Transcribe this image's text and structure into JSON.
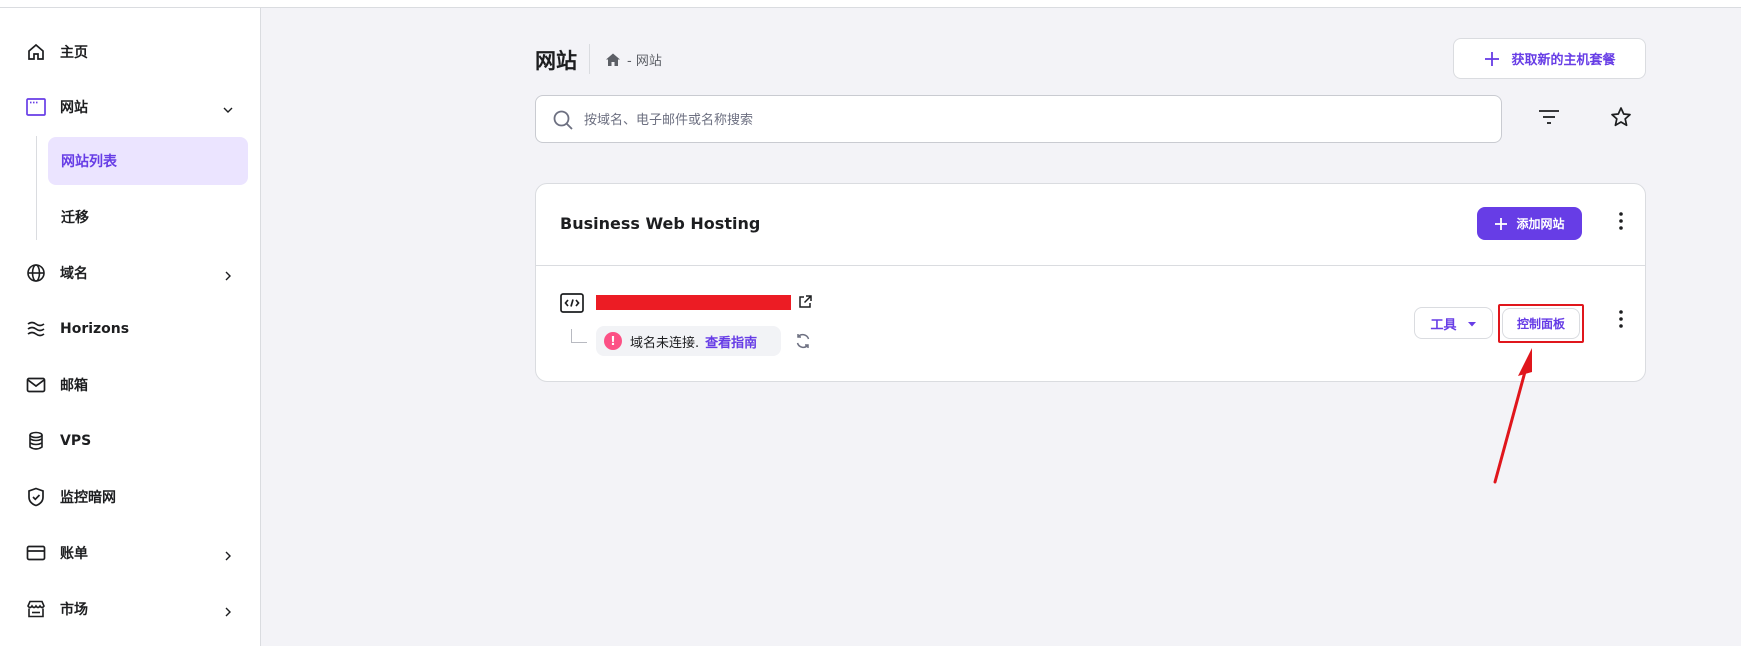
{
  "sidebar": {
    "items": [
      {
        "label": "主页",
        "icon": "home-icon"
      },
      {
        "label": "网站",
        "icon": "browser-window-icon",
        "expanded": true
      },
      {
        "label": "域名",
        "icon": "globe-icon"
      },
      {
        "label": "Horizons",
        "icon": "waves-icon"
      },
      {
        "label": "邮箱",
        "icon": "mail-icon"
      },
      {
        "label": "VPS",
        "icon": "database-icon"
      },
      {
        "label": "监控暗网",
        "icon": "shield-icon"
      },
      {
        "label": "账单",
        "icon": "card-icon"
      },
      {
        "label": "市场",
        "icon": "store-icon"
      }
    ],
    "sub_items": [
      {
        "label": "网站列表",
        "active": true
      },
      {
        "label": "迁移"
      }
    ]
  },
  "header": {
    "title": "网站",
    "breadcrumb": "- 网站",
    "get_hosting_label": "获取新的主机套餐"
  },
  "search": {
    "placeholder": "按域名、电子邮件或名称搜索",
    "value": ""
  },
  "card": {
    "title": "Business Web Hosting",
    "add_site_label": "添加网站",
    "site": {
      "status_text": "域名未连接.",
      "guide_link": "查看指南",
      "tools_label": "工具",
      "control_panel_label": "控制面板"
    }
  },
  "colors": {
    "accent": "#673de6",
    "warning": "#fc5185",
    "annotation": "#e0161c"
  }
}
